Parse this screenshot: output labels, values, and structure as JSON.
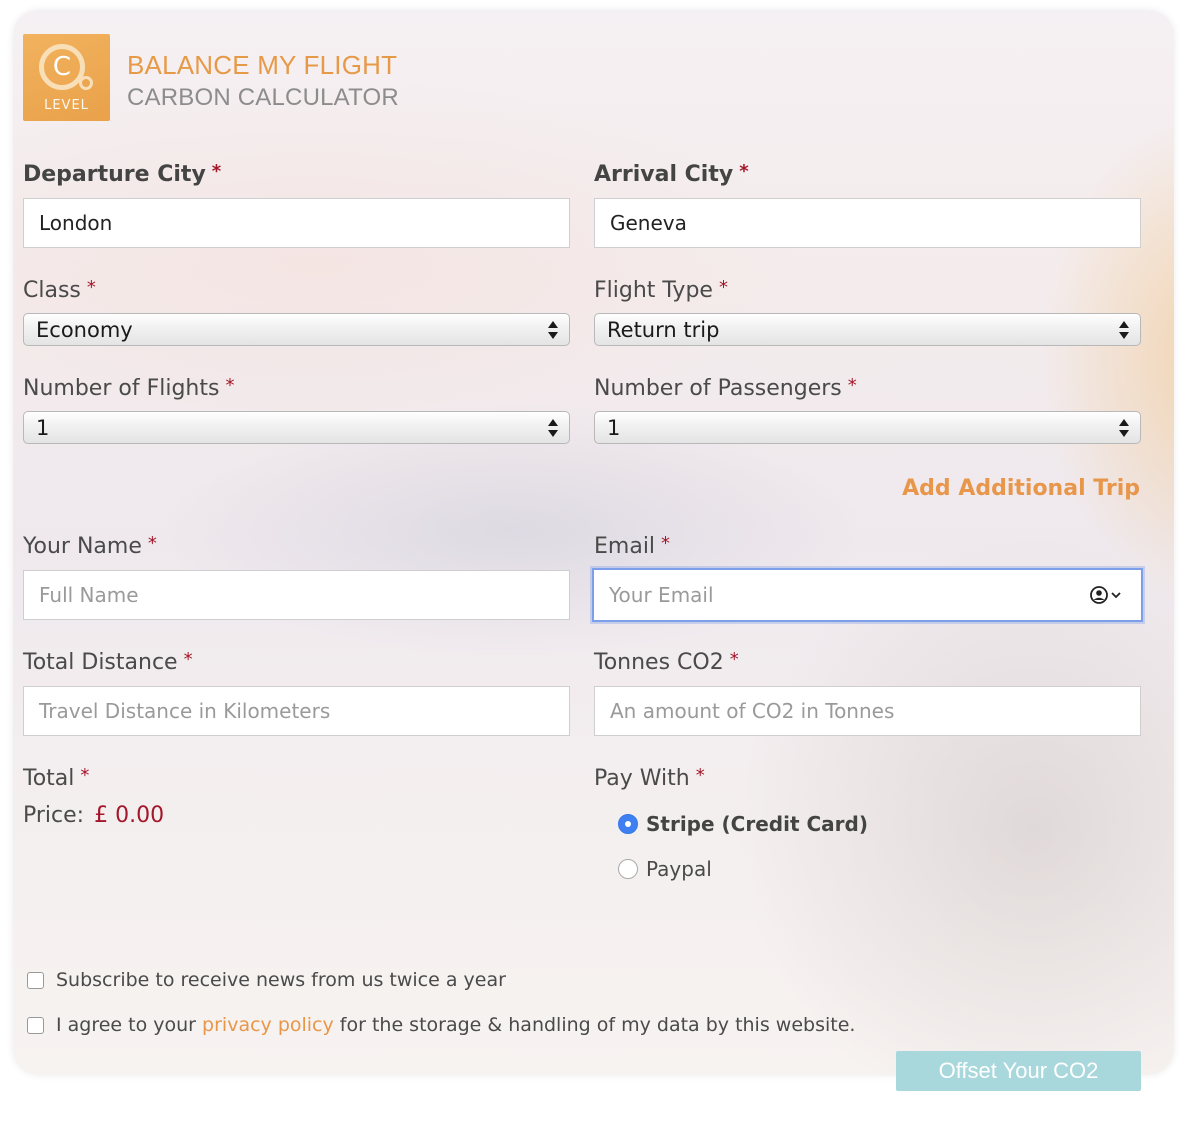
{
  "brand": {
    "logo_glyph": "C",
    "logo_text": "LEVEL",
    "title": "BALANCE MY FLIGHT",
    "subtitle": "CARBON CALCULATOR"
  },
  "fields": {
    "departure": {
      "label": "Departure City",
      "value": "London"
    },
    "arrival": {
      "label": "Arrival City",
      "value": "Geneva"
    },
    "class": {
      "label": "Class",
      "selected": "Economy"
    },
    "flight_type": {
      "label": "Flight Type",
      "selected": "Return trip"
    },
    "num_flights": {
      "label": "Number of Flights",
      "selected": "1"
    },
    "num_passengers": {
      "label": "Number of Passengers",
      "selected": "1"
    },
    "name": {
      "label": "Your Name",
      "placeholder": "Full Name"
    },
    "email": {
      "label": "Email",
      "placeholder": "Your Email"
    },
    "distance": {
      "label": "Total Distance",
      "placeholder": "Travel Distance in Kilometers"
    },
    "co2": {
      "label": "Tonnes CO2",
      "placeholder": "An amount of CO2 in Tonnes"
    }
  },
  "required_mark": "*",
  "add_trip_label": "Add Additional Trip",
  "total": {
    "label": "Total",
    "price_label": "Price:",
    "price_value": "£ 0.00"
  },
  "payment": {
    "label": "Pay With",
    "options": [
      {
        "label": "Stripe (Credit Card)",
        "selected": true
      },
      {
        "label": "Paypal",
        "selected": false
      }
    ]
  },
  "subscribe_label": "Subscribe to receive news from us twice a year",
  "agree": {
    "prefix": "I agree to your",
    "link": "privacy policy",
    "suffix": "for the storage & handling of my data by this website."
  },
  "submit_label": "Offset Your CO2",
  "colors": {
    "brand_orange": "#e69a48",
    "required_red": "#a3172a",
    "submit_bg": "#a8d7dc",
    "focus_blue": "#7d9ee8"
  }
}
